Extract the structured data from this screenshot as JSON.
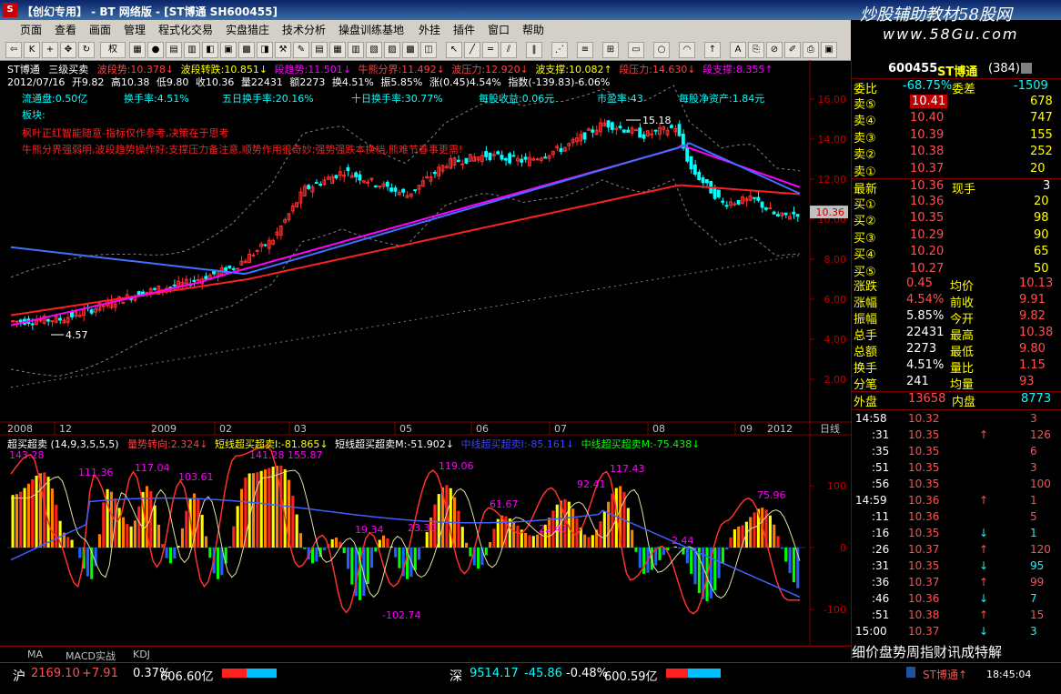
{
  "window": {
    "title": "【创幻专用】 - BT 网络版 - [ST博通 SH600455]",
    "watermark": "炒股辅助教材58股网",
    "watermark_url": "www.58Gu.com"
  },
  "menu": [
    "页面",
    "查看",
    "画面",
    "管理",
    "程式化交易",
    "实盘猎庄",
    "技术分析",
    "操盘训练基地",
    "外挂",
    "插件",
    "窗口",
    "帮助"
  ],
  "toolbar": {
    "period_label": "权"
  },
  "indicator_header": {
    "name": "ST博通",
    "type": "三级买卖",
    "items": [
      {
        "label": "波段势:10.378↓",
        "color": "#ff4040"
      },
      {
        "label": "波段转跌:10.851↓",
        "color": "#ffff00"
      },
      {
        "label": "段趋势:11.501↓",
        "color": "#ff00ff"
      },
      {
        "label": "牛熊分界:11.492↓",
        "color": "#ff4040"
      },
      {
        "label": "波压力:12.920↓",
        "color": "#ff4040"
      },
      {
        "label": "波支撑:10.082↑",
        "color": "#ffff00"
      },
      {
        "label": "段压力:14.630↓",
        "color": "#ff4040"
      },
      {
        "label": "段支撑:8.355↑",
        "color": "#ff00ff"
      }
    ]
  },
  "ohlc_line": {
    "date": "2012/07/16",
    "open": "开9.82",
    "high": "高10.38",
    "low": "低9.80",
    "close": "收10.36",
    "vol": "量22431",
    "amount": "额2273",
    "turnover": "换4.51%",
    "amplitude": "振5.85%",
    "change": "涨(0.45)4.54%",
    "index": "指数(-139.83)-6.06%"
  },
  "fundamentals": {
    "float": "流通盘:0.50亿",
    "turnover": "换手率:4.51%",
    "t5": "五日换手率:20.16%",
    "t10": "十日换手率:30.77%",
    "eps": "每股收益:0.06元",
    "pe": "市盈率:43",
    "nav": "每股净资产:1.84元",
    "sector": "板块:"
  },
  "notes": [
    "枫叶正红智能随意-指标仅作参考,决策在于思考",
    "牛熊分界强弱明,波段趋势操作好;支撑压力备注意,顺势作用很奇妙;强势强跌本换档,熊难节春事更需!"
  ],
  "price_axis": [
    "16.00",
    "14.00",
    "12.00",
    "10.00",
    "8.00",
    "6.00",
    "4.00",
    "2.00"
  ],
  "price_labels": {
    "high": "15.18",
    "low": "4.57",
    "last": "10.36"
  },
  "time_axis": [
    "2008",
    "12",
    "2009",
    "02",
    "03",
    "05",
    "06",
    "07",
    "08",
    "09",
    "2012"
  ],
  "time_axis_right": "日线",
  "osc_header": {
    "name": "超买超卖",
    "params": "(14,9,3,5,5,5)",
    "items": [
      {
        "label": "量势转向:2.324↓",
        "color": "#ff4040"
      },
      {
        "label": "短线超买超卖I:-81.865↓",
        "color": "#ffff00"
      },
      {
        "label": "短线超买超卖M:-51.902↓",
        "color": "#ffffff"
      },
      {
        "label": "中线超买超卖I:-85.161↓",
        "color": "#4040ff"
      },
      {
        "label": "中线超买超卖M:-75.438↓",
        "color": "#00ff00"
      }
    ]
  },
  "osc_axis": [
    "100",
    "0",
    "-100"
  ],
  "osc_peaks": [
    "143.28",
    "111.36",
    "117.04",
    "103.61",
    "141.28",
    "155.87",
    "19.34",
    "23.30",
    "119.06",
    "61.67",
    "22.47",
    "92.41",
    "117.43",
    "2.44",
    "75.96",
    "-102.74"
  ],
  "bottom_tabs": [
    "MA",
    "MACD实战",
    "KDJ"
  ],
  "quote": {
    "code": "600455",
    "name": "ST博通",
    "num": "(384)",
    "weibi_label": "委比",
    "weibi": "-68.75%",
    "weicha_label": "委差",
    "weicha": "-1509",
    "asks": [
      {
        "label": "卖⑤",
        "price": "10.41",
        "vol": "678"
      },
      {
        "label": "卖④",
        "price": "10.40",
        "vol": "747"
      },
      {
        "label": "卖③",
        "price": "10.39",
        "vol": "155"
      },
      {
        "label": "卖②",
        "price": "10.38",
        "vol": "252"
      },
      {
        "label": "卖①",
        "price": "10.37",
        "vol": "20"
      }
    ],
    "last_label": "最新",
    "last": "10.36",
    "current_label": "现手",
    "current": "3",
    "bids": [
      {
        "label": "买①",
        "price": "10.36",
        "vol": "20"
      },
      {
        "label": "买②",
        "price": "10.35",
        "vol": "98"
      },
      {
        "label": "买③",
        "price": "10.29",
        "vol": "90"
      },
      {
        "label": "买④",
        "price": "10.20",
        "vol": "65"
      },
      {
        "label": "买⑤",
        "price": "10.27",
        "vol": "50"
      }
    ],
    "stats": [
      {
        "l1": "涨跌",
        "v1": "0.45",
        "l2": "均价",
        "v2": "10.13"
      },
      {
        "l1": "涨幅",
        "v1": "4.54%",
        "l2": "前收",
        "v2": "9.91"
      },
      {
        "l1": "振幅",
        "v1": "5.85%",
        "l2": "今开",
        "v2": "9.82"
      },
      {
        "l1": "总手",
        "v1": "22431",
        "l2": "最高",
        "v2": "10.38"
      },
      {
        "l1": "总额",
        "v1": "2273",
        "l2": "最低",
        "v2": "9.80"
      },
      {
        "l1": "换手",
        "v1": "4.51%",
        "l2": "量比",
        "v2": "1.15"
      },
      {
        "l1": "分笔",
        "v1": "241",
        "l2": "均量",
        "v2": "93"
      }
    ],
    "outer_label": "外盘",
    "outer": "13658",
    "inner_label": "内盘",
    "inner": "8773"
  },
  "ticks": [
    {
      "t": "14:58",
      "p": "10.32",
      "a": "",
      "v": "3"
    },
    {
      "t": ":31",
      "p": "10.35",
      "a": "↑",
      "v": "126"
    },
    {
      "t": ":35",
      "p": "10.35",
      "a": "",
      "v": "6"
    },
    {
      "t": ":51",
      "p": "10.35",
      "a": "",
      "v": "3"
    },
    {
      "t": ":56",
      "p": "10.35",
      "a": "",
      "v": "100"
    },
    {
      "t": "14:59",
      "p": "10.36",
      "a": "↑",
      "v": "1"
    },
    {
      "t": ":11",
      "p": "10.36",
      "a": "",
      "v": "5"
    },
    {
      "t": ":16",
      "p": "10.35",
      "a": "↓",
      "v": "1"
    },
    {
      "t": ":26",
      "p": "10.37",
      "a": "↑",
      "v": "120"
    },
    {
      "t": ":31",
      "p": "10.35",
      "a": "↓",
      "v": "95"
    },
    {
      "t": ":36",
      "p": "10.37",
      "a": "↑",
      "v": "99"
    },
    {
      "t": ":46",
      "p": "10.36",
      "a": "↓",
      "v": "7"
    },
    {
      "t": ":51",
      "p": "10.38",
      "a": "↑",
      "v": "15"
    },
    {
      "t": "15:00",
      "p": "10.37",
      "a": "↓",
      "v": "3"
    }
  ],
  "right_bottom_text": "细价盘势周指财讯成特解",
  "status": {
    "sh_label": "沪",
    "sh_index": "2169.10",
    "sh_change": "+7.91",
    "sh_pct": "0.37%",
    "sh_amount": "606.60亿",
    "sz_label": "深",
    "sz_index": "9514.17",
    "sz_change": "-45.86",
    "sz_pct": "-0.48%",
    "sz_amount": "600.59亿",
    "stock": "ST博通↑",
    "time": "18:45:04"
  },
  "colors": {
    "up": "#ff5050",
    "down": "#00ffff",
    "axis": "#800000",
    "ma_pink": "#ff00ff",
    "ma_red": "#ff2020",
    "ma_blue": "#4070ff"
  }
}
